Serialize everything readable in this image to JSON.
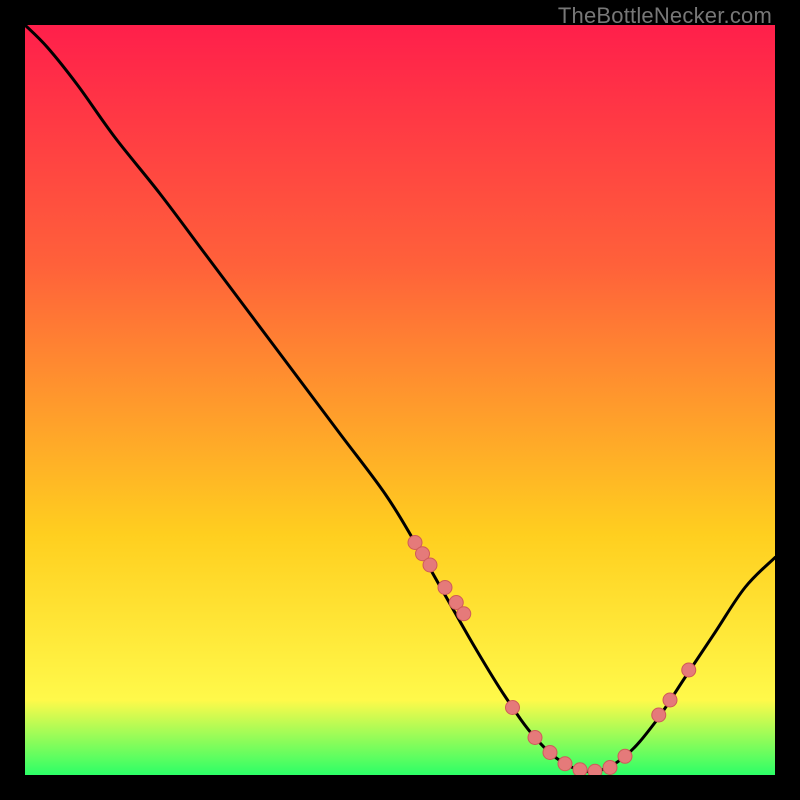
{
  "watermark": "TheBottleNecker.com",
  "colors": {
    "grad_top": "#ff1f4b",
    "grad_mid1": "#ff613a",
    "grad_mid2": "#ffcf1f",
    "grad_mid3": "#fff94a",
    "grad_bot": "#2cff67",
    "curve": "#000000",
    "dot_fill": "#e57a7a",
    "dot_stroke": "#cf5a5a",
    "frame_bg": "#000000"
  },
  "chart_data": {
    "type": "line",
    "title": "",
    "xlabel": "",
    "ylabel": "",
    "xlim": [
      0,
      100
    ],
    "ylim": [
      0,
      100
    ],
    "x": [
      0,
      3,
      7,
      12,
      18,
      24,
      30,
      36,
      42,
      48,
      52,
      56,
      60,
      64,
      68,
      72,
      76,
      80,
      84,
      88,
      92,
      96,
      100
    ],
    "y": [
      100,
      97,
      92,
      85,
      77.5,
      69.5,
      61.5,
      53.5,
      45.5,
      37.5,
      31,
      24,
      17,
      10.5,
      5,
      1.5,
      0.5,
      2.5,
      7,
      13,
      19,
      25,
      29
    ],
    "series": [
      {
        "name": "dots",
        "type": "scatter",
        "x": [
          52,
          53,
          54,
          56,
          57.5,
          58.5,
          65,
          68,
          70,
          72,
          74,
          76,
          78,
          80,
          84.5,
          86,
          88.5
        ],
        "y": [
          31,
          29.5,
          28,
          25,
          23,
          21.5,
          9,
          5,
          3,
          1.5,
          0.7,
          0.5,
          1,
          2.5,
          8,
          10,
          14
        ]
      }
    ]
  }
}
